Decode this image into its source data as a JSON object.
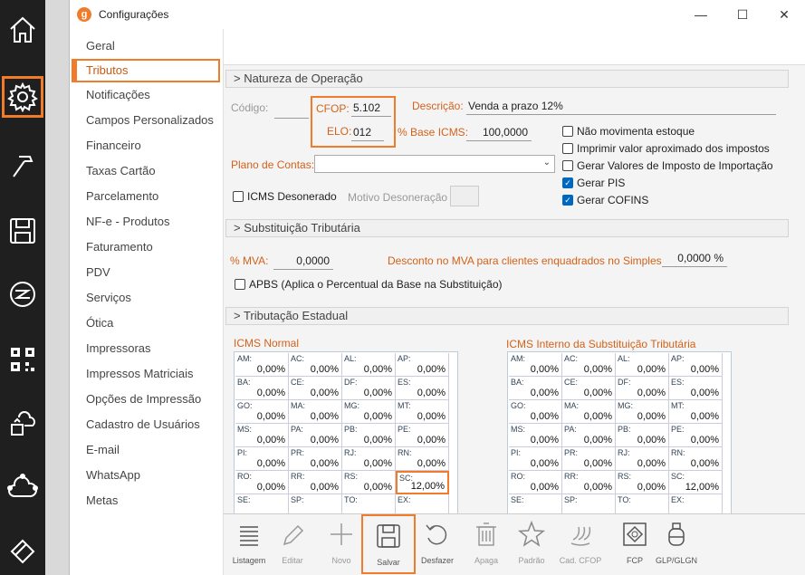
{
  "window": {
    "title": "Configurações",
    "logo_letter": "g",
    "minimize": "—",
    "maximize": "☐",
    "close": "✕"
  },
  "rail": [
    "home-icon",
    "gear-icon",
    "hammer-icon",
    "save-icon",
    "brand-icon",
    "qr-code-icon",
    "cloud-sync-icon",
    "network-cloud-icon",
    "tags-icon"
  ],
  "nav": {
    "items": [
      "Geral",
      "Tributos",
      "Notificações",
      "Campos Personalizados",
      "Financeiro",
      "Taxas Cartão",
      "Parcelamento",
      "NF-e - Produtos",
      "Faturamento",
      "PDV",
      "Serviços",
      "Ótica",
      "Impressoras",
      "Impressos Matriciais",
      "Opções de Impressão",
      "Cadastro de Usuários",
      "E-mail",
      "WhatsApp",
      "Metas"
    ],
    "active": "Tributos"
  },
  "natureza": {
    "header": "> Natureza de Operação",
    "codigo_label": "Código:",
    "codigo_value": "",
    "cfop_label": "CFOP:",
    "cfop_value": "5.102",
    "elo_label": "ELO:",
    "elo_value": "012",
    "descricao_label": "Descrição:",
    "descricao_value": "Venda a prazo 12%",
    "base_icms_label": "% Base ICMS:",
    "base_icms_value": "100,0000",
    "plano_label": "Plano de Contas:",
    "plano_value": "",
    "icms_desonerado": "ICMS Desonerado",
    "motivo_label": "Motivo Desoneração",
    "checks": [
      {
        "label": "Não movimenta estoque",
        "checked": false
      },
      {
        "label": "Imprimir valor aproximado dos impostos",
        "checked": false
      },
      {
        "label": "Gerar Valores de Imposto de Importação",
        "checked": false
      },
      {
        "label": "Gerar PIS",
        "checked": true
      },
      {
        "label": "Gerar COFINS",
        "checked": true
      }
    ]
  },
  "st": {
    "header": "> Substituição Tributária",
    "mva_label": "% MVA:",
    "mva_value": "0,0000",
    "desconto_label": "Desconto no MVA para clientes enquadrados no Simples",
    "desconto_value": "0,0000 %",
    "apbs": "APBS (Aplica o Percentual da Base na Substituição)"
  },
  "estadual": {
    "header": "> Tributação Estadual",
    "icms_normal_title": "ICMS Normal",
    "icms_st_title": "ICMS Interno da Substituição Tributária",
    "icms_normal": [
      [
        "AM:",
        "0,00%"
      ],
      [
        "AC:",
        "0,00%"
      ],
      [
        "AL:",
        "0,00%"
      ],
      [
        "AP:",
        "0,00%"
      ],
      [
        "BA:",
        "0,00%"
      ],
      [
        "CE:",
        "0,00%"
      ],
      [
        "DF:",
        "0,00%"
      ],
      [
        "ES:",
        "0,00%"
      ],
      [
        "GO:",
        "0,00%"
      ],
      [
        "MA:",
        "0,00%"
      ],
      [
        "MG:",
        "0,00%"
      ],
      [
        "MT:",
        "0,00%"
      ],
      [
        "MS:",
        "0,00%"
      ],
      [
        "PA:",
        "0,00%"
      ],
      [
        "PB:",
        "0,00%"
      ],
      [
        "PE:",
        "0,00%"
      ],
      [
        "PI:",
        "0,00%"
      ],
      [
        "PR:",
        "0,00%"
      ],
      [
        "RJ:",
        "0,00%"
      ],
      [
        "RN:",
        "0,00%"
      ],
      [
        "RO:",
        "0,00%"
      ],
      [
        "RR:",
        "0,00%"
      ],
      [
        "RS:",
        "0,00%"
      ],
      [
        "SC:",
        "12,00%"
      ],
      [
        "SE:",
        ""
      ],
      [
        "SP:",
        ""
      ],
      [
        "TO:",
        ""
      ],
      [
        "EX:",
        ""
      ]
    ],
    "icms_st": [
      [
        "AM:",
        "0,00%"
      ],
      [
        "AC:",
        "0,00%"
      ],
      [
        "AL:",
        "0,00%"
      ],
      [
        "AP:",
        "0,00%"
      ],
      [
        "BA:",
        "0,00%"
      ],
      [
        "CE:",
        "0,00%"
      ],
      [
        "DF:",
        "0,00%"
      ],
      [
        "ES:",
        "0,00%"
      ],
      [
        "GO:",
        "0,00%"
      ],
      [
        "MA:",
        "0,00%"
      ],
      [
        "MG:",
        "0,00%"
      ],
      [
        "MT:",
        "0,00%"
      ],
      [
        "MS:",
        "0,00%"
      ],
      [
        "PA:",
        "0,00%"
      ],
      [
        "PB:",
        "0,00%"
      ],
      [
        "PE:",
        "0,00%"
      ],
      [
        "PI:",
        "0,00%"
      ],
      [
        "PR:",
        "0,00%"
      ],
      [
        "RJ:",
        "0,00%"
      ],
      [
        "RN:",
        "0,00%"
      ],
      [
        "RO:",
        "0,00%"
      ],
      [
        "RR:",
        "0,00%"
      ],
      [
        "RS:",
        "0,00%"
      ],
      [
        "SC:",
        "12,00%"
      ],
      [
        "SE:",
        ""
      ],
      [
        "SP:",
        ""
      ],
      [
        "TO:",
        ""
      ],
      [
        "EX:",
        ""
      ]
    ]
  },
  "toolbar": [
    {
      "label": "Listagem",
      "icon": "list-icon",
      "enabled": true
    },
    {
      "label": "Editar",
      "icon": "pencil-icon",
      "enabled": false
    },
    {
      "label": "Novo",
      "icon": "plus-icon",
      "enabled": false
    },
    {
      "label": "Salvar",
      "icon": "floppy-icon",
      "enabled": true
    },
    {
      "label": "Desfazer",
      "icon": "undo-icon",
      "enabled": true
    },
    {
      "label": "Apaga",
      "icon": "trash-icon",
      "enabled": false
    },
    {
      "label": "Padrão",
      "icon": "star-icon",
      "enabled": false
    },
    {
      "label": "Cad. CFOP",
      "icon": "cfop-icon",
      "enabled": false
    },
    {
      "label": "FCP",
      "icon": "fcp-icon",
      "enabled": true
    },
    {
      "label": "GLP/GLGN",
      "icon": "gas-cylinder-icon",
      "enabled": true
    }
  ],
  "colors": {
    "accent": "#f07b2a",
    "label_orange": "#d2621b",
    "checkbox_blue": "#0067c0",
    "rail_bg": "#1f1f1f"
  }
}
